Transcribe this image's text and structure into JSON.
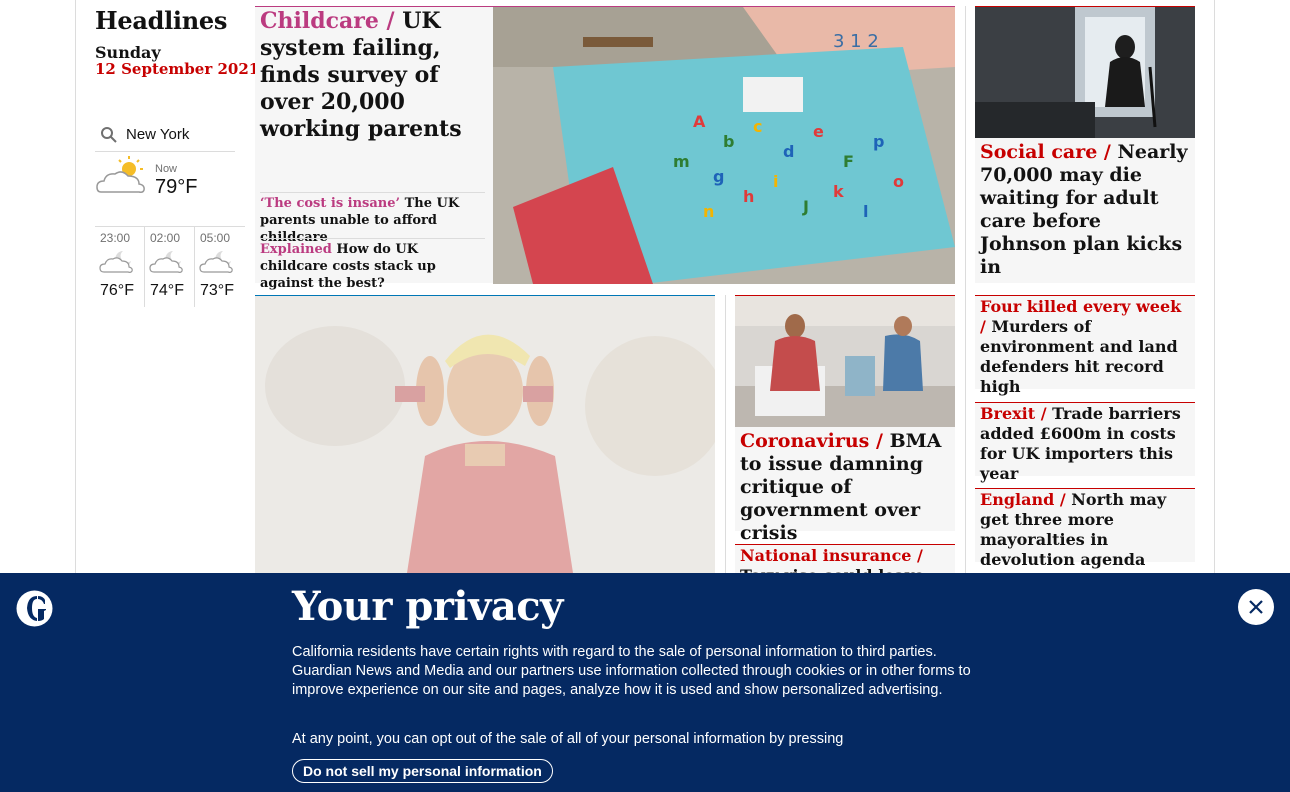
{
  "sidebar": {
    "title": "Headlines",
    "day": "Sunday",
    "date": "12 September 2021",
    "location": "New York",
    "now_label": "Now",
    "now_temp": "79°F",
    "forecast": [
      {
        "time": "23:00",
        "temp": "76°F"
      },
      {
        "time": "02:00",
        "temp": "74°F"
      },
      {
        "time": "05:00",
        "temp": "73°F"
      }
    ]
  },
  "childcare": {
    "kicker": "Childcare /",
    "headline": "UK system failing, finds survey of over 20,000 working parents",
    "sub1_kicker": "‘The cost is insane’",
    "sub1_text": "The UK parents unable to afford childcare",
    "sub2_kicker": "Explained",
    "sub2_text": "How do UK childcare costs stack up against the best?"
  },
  "social": {
    "kicker": "Social care /",
    "headline": "Nearly 70,000 may die waiting for adult care before Johnson plan kicks in"
  },
  "corona": {
    "kicker": "Coronavirus /",
    "headline": "BMA to issue damning critique of government over crisis"
  },
  "ni": {
    "kicker": "National insurance /",
    "headline": "Tory rise could leave low-paid"
  },
  "four_killed": {
    "kicker": "Four killed every week /",
    "headline": "Murders of environment and land defenders hit record high"
  },
  "brexit": {
    "kicker": "Brexit /",
    "headline": "Trade barriers added £600m in costs for UK importers this year"
  },
  "england": {
    "kicker": "England /",
    "headline": "North may get three more mayoralties in devolution agenda"
  },
  "privacy": {
    "title": "Your privacy",
    "text": "California residents have certain rights with regard to the sale of personal information to third parties. Guardian News and Media and our partners use information collected through cookies or in other forms to improve experience on our site and pages, analyze how it is used and show personalized advertising.",
    "text2": "At any point, you can opt out of the sale of all of your personal information by pressing",
    "button": "Do not sell my personal information"
  },
  "colors": {
    "news_red": "#c70000",
    "lifestyle_pink": "#bb3b80",
    "banner_blue": "#052962"
  }
}
